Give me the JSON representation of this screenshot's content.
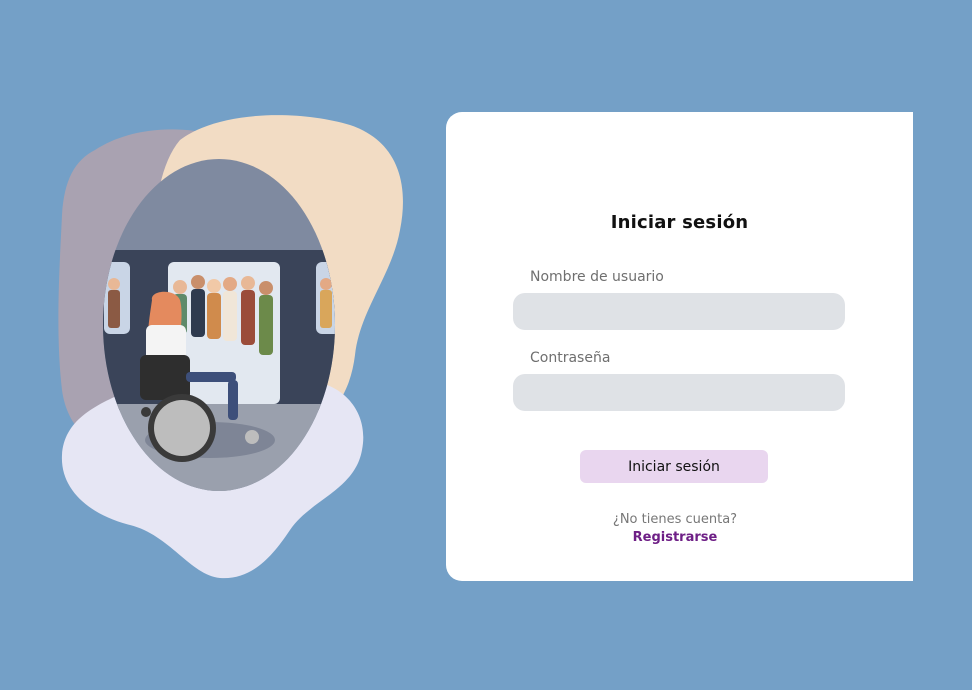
{
  "login": {
    "title": "Iniciar sesión",
    "username_label": "Nombre de usuario",
    "username_value": "",
    "password_label": "Contraseña",
    "password_value": "",
    "submit_label": "Iniciar sesión",
    "no_account_text": "¿No tienes cuenta?",
    "register_label": "Registrarse"
  },
  "colors": {
    "background": "#74a0c7",
    "card": "#ffffff",
    "input_fill": "#dfe2e6",
    "button_fill": "#e9d6ef",
    "link": "#6e1f86",
    "blob_mauve": "#a9a2b1",
    "blob_peach": "#f2dcc4",
    "blob_lavender": "#e6e6f4"
  },
  "illustration": {
    "scene": "subway-train-wheelchair-user-icon"
  }
}
